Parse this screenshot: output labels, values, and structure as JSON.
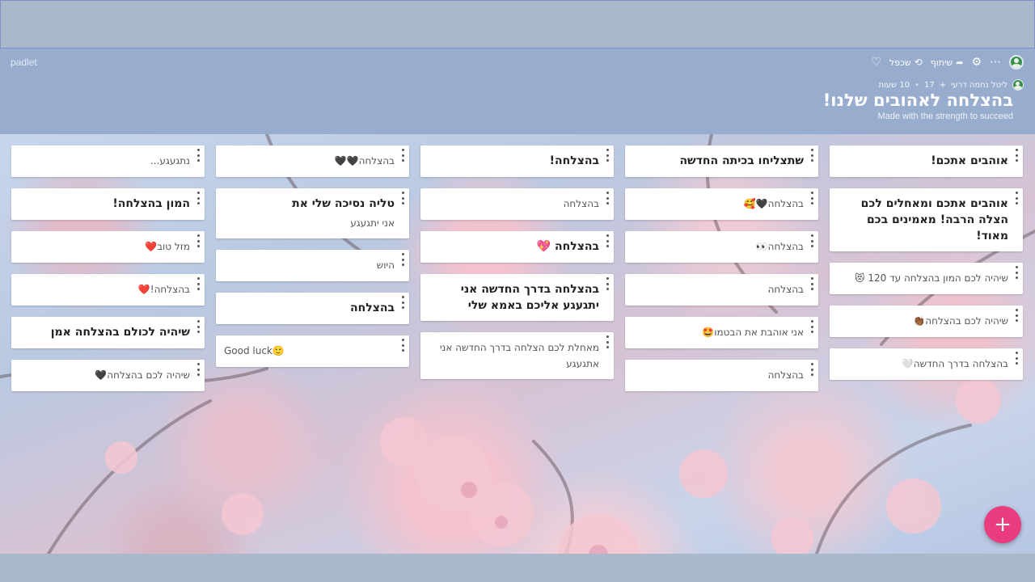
{
  "header": {
    "logo": "padlet",
    "toolbar": {
      "share_label": "שיתוף",
      "remake_label": "שכפל"
    },
    "meta": {
      "author": "ליטל נחמה דרעי",
      "likes": "17",
      "time_ago": "10 שעות"
    },
    "title": "בהצלחה לאהובים שלנו!",
    "subtitle": "Made with the strength to succeed"
  },
  "columns": [
    {
      "posts": [
        {
          "title": "אוהבים אתכם!",
          "body": ""
        },
        {
          "title": "אוהבים אתכם ומאחלים לכם הצלה הרבה! מאמינים בכם מאוד!",
          "body": ""
        },
        {
          "title": "",
          "body": "שיהיה לכם המון בהצלחה עד 120 😻"
        },
        {
          "title": "",
          "body": "שיהיה לכם בהצלחה👏🏾"
        },
        {
          "title": "",
          "body": "בהצלחה בדרך החדשה🤍"
        }
      ]
    },
    {
      "posts": [
        {
          "title": "שתצליחו בכיתה החדשה",
          "body": ""
        },
        {
          "title": "",
          "body": "בהצלחה🖤🥰"
        },
        {
          "title": "",
          "body": "בהצלחה👀"
        },
        {
          "title": "",
          "body": "בהצלחה"
        },
        {
          "title": "",
          "body": "אני אוהבת את הבטמו🤩"
        },
        {
          "title": "",
          "body": "בהצלחה"
        }
      ]
    },
    {
      "posts": [
        {
          "title": "בהצלחה!",
          "body": ""
        },
        {
          "title": "",
          "body": "בהצלחה"
        },
        {
          "title": "בהצלחה 💖",
          "body": ""
        },
        {
          "title": "בהצלחה בדרך החדשה אני יתגעגע אליכם באמא שלי",
          "body": ""
        },
        {
          "title": "",
          "body": "מאחלת לכם הצלחה בדרך החדשה אני אתגעגע"
        }
      ]
    },
    {
      "posts": [
        {
          "title": "",
          "body": "בהצלחה🖤🖤"
        },
        {
          "title": "טליה נסיכה שלי את",
          "body": "אני יתגעגע"
        },
        {
          "title": "",
          "body": "היוש"
        },
        {
          "title": "בהצלחה",
          "body": ""
        },
        {
          "title": "",
          "body": "Good luck🙂"
        }
      ]
    },
    {
      "posts": [
        {
          "title": "",
          "body": "נתגעגע..."
        },
        {
          "title": "המון בהצלחה!",
          "body": ""
        },
        {
          "title": "",
          "body": "מזל טוב❤️"
        },
        {
          "title": "",
          "body": "בהצלחה!❤️"
        },
        {
          "title": "שיהיה לכולם בהצלחה אמן",
          "body": ""
        },
        {
          "title": "",
          "body": "שיהיה לכם בהצלחה🖤"
        }
      ]
    }
  ],
  "fab_label": "+",
  "colors": {
    "header_bg": "#98adce",
    "fab": "#ea3d7f",
    "card_bg": "#ffffff"
  }
}
